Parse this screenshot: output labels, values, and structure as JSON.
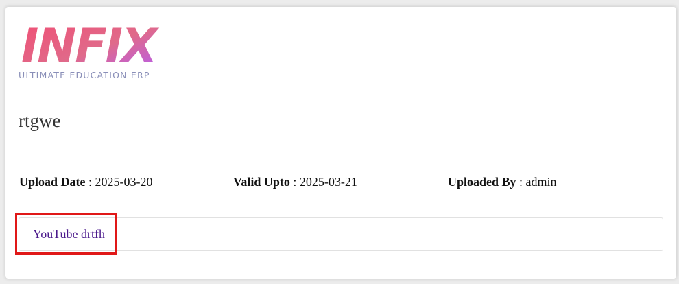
{
  "logo": {
    "wordmark": "INFIX",
    "tagline": "ULTIMATE EDUCATION ERP",
    "gradient_colors": [
      "#f04f74",
      "#b45cf2"
    ]
  },
  "content": {
    "title": "rtgwe",
    "upload_date_label": "Upload Date",
    "upload_date_value": " : 2025-03-20",
    "valid_upto_label": "Valid Upto",
    "valid_upto_value": " : 2025-03-21",
    "uploaded_by_label": "Uploaded By",
    "uploaded_by_value": " : admin",
    "link_text": "YouTube drtfh"
  },
  "colors": {
    "link": "#4b1a8c",
    "highlight_border": "#e01818"
  }
}
